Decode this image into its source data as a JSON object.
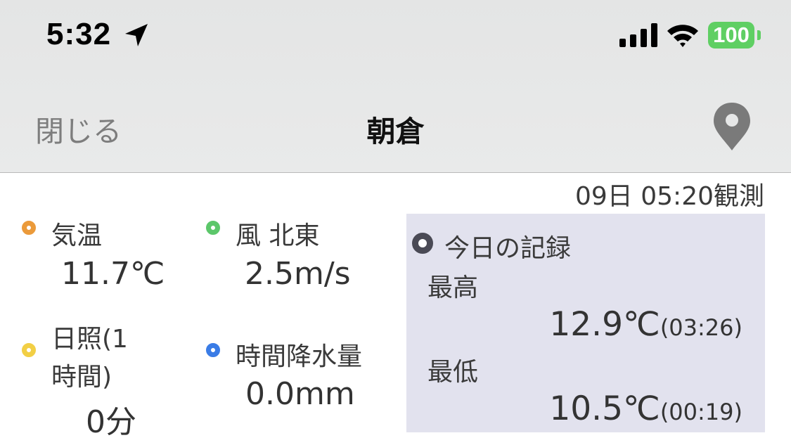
{
  "status_bar": {
    "time": "5:32",
    "battery": "100",
    "colors": {
      "battery": "#5fcf63"
    }
  },
  "nav": {
    "close_label": "閉じる",
    "title": "朝倉",
    "pin_icon": "map-pin-icon"
  },
  "observation": {
    "time_label": "09日 05:20観測"
  },
  "metrics": {
    "temperature": {
      "label": "気温",
      "value": "11.7℃",
      "color": "#eb9a3a"
    },
    "wind": {
      "label": "風 北東",
      "value": "2.5m/s",
      "color": "#5cc76a"
    },
    "sunshine": {
      "label_line1": "日照(1",
      "label_line2": "時間)",
      "value": "0分",
      "color": "#f2cf45"
    },
    "precipitation": {
      "label": "時間降水量",
      "value": "0.0mm",
      "color": "#3a7ce6"
    }
  },
  "today_record": {
    "title": "今日の記録",
    "high_label": "最高",
    "high_value": "12.9℃",
    "high_time": "(03:26)",
    "low_label": "最低",
    "low_value": "10.5℃",
    "low_time": "(00:19)",
    "color": "#4a4a55"
  }
}
